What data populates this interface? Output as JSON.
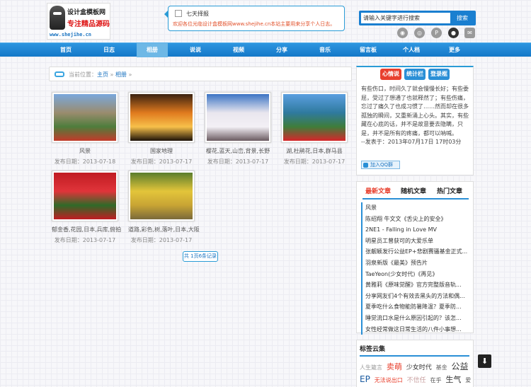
{
  "logo": {
    "title": "设计盒模板网",
    "slogan": "专注精品源码",
    "url": "www.shejihe.cn"
  },
  "notice": {
    "title": "七天择报",
    "text": "欢迎各位光临设计盒模板网www.shejihe.cn本站主要用来分享个人日志。"
  },
  "search": {
    "value": "请输入关键字进行搜索",
    "button": "搜索"
  },
  "social_icons": [
    "rss-icon",
    "weibo-icon",
    "qq-icon",
    "tencent-icon",
    "mail-icon"
  ],
  "nav": {
    "items": [
      "首页",
      "日志",
      "相册",
      "说说",
      "视频",
      "分享",
      "音乐",
      "留言板",
      "个人档",
      "更多"
    ],
    "active_index": 2
  },
  "breadcrumb": {
    "prefix": "当前位置：",
    "home": "主页",
    "sep": "»",
    "current": "相册",
    "end": "»"
  },
  "photos": [
    {
      "caption": "风景",
      "date": "发布日期：2013-07-18",
      "colors": [
        "#7aa8dc",
        "#9a8c6e",
        "#4e7d3c",
        "#c23a2a"
      ]
    },
    {
      "caption": "国家地理",
      "date": "发布日期：2013-07-17",
      "colors": [
        "#3a2210",
        "#e07a1e",
        "#f7c04a",
        "#1c1208"
      ]
    },
    {
      "caption": "樱花,蓝天,山峦,背景,长野",
      "date": "发布日期：2013-07-17",
      "colors": [
        "#3c74c4",
        "#e9e6ee",
        "#f3f0f5",
        "#6a5a60"
      ]
    },
    {
      "caption": "湖,杜鹃花,日本,群马县",
      "date": "发布日期：2013-07-17",
      "colors": [
        "#5b9fe0",
        "#2f7a9e",
        "#3f7d3a",
        "#d6262a"
      ]
    },
    {
      "caption": "郁金香,花园,日本,兵库,俯拍",
      "date": "发布日期：2013-07-17",
      "colors": [
        "#c01c22",
        "#e0343a",
        "#2f6a28",
        "#c01c22"
      ]
    },
    {
      "caption": "道路,彩色,树,落叶,日本,大阪",
      "date": "发布日期：2013-07-17",
      "colors": [
        "#5a7d2c",
        "#e3c53a",
        "#c8a434",
        "#7a6a3a"
      ]
    }
  ],
  "pager": "共 1页6条记录",
  "about": {
    "tabs": [
      "心情说",
      "统计栏",
      "登录框"
    ],
    "text": "有些伤口，时间久了就会慢慢长好；有些委屈，受过了想通了也就释然了；有些伤痛，忘过了痛久了也成习惯了……然而却在很多孤独的瞬间，又重新涌上心头。其实，有些藏在心底的话，并不是故意要去隐瞒，只是，并不是所有的疼痛，都可以呐喊。",
    "date": "--发表于：2013年07月17日 17时03分",
    "qq": "加入QQ群"
  },
  "articles": {
    "tabs": [
      "最新文章",
      "随机文章",
      "热门文章"
    ],
    "items": [
      "风景",
      "陈绍翔 牛文文《舌尖上的安全》",
      "2NE1 - Falling in Love MV",
      "明星员工曾获可的大爱乐单",
      "张靓颖发行公益EP+悲剧赛骚基金正式...",
      "羽泉新版《最美》预告片",
      "TaeYeon(少女时代)《再见》",
      "黄雅莉《原味觉醒》官方完整版音轨...",
      "分享网友们4个有效去黑头的方法和偶...",
      "夏季吃什么食物能防暑降温？夏季防...",
      "睡觉流口水是什么原因引起的？该怎...",
      "女性经常做这日常生活的八件小事想..."
    ]
  },
  "tags": {
    "title": "标签云集",
    "items": [
      {
        "text": "人生箴言",
        "size": 8,
        "color": "#9a9a9a"
      },
      {
        "text": "卖萌",
        "size": 11,
        "color": "#e8402e"
      },
      {
        "text": "少女时代",
        "size": 9,
        "color": "#333333"
      },
      {
        "text": "基金",
        "size": 8,
        "color": "#666666"
      },
      {
        "text": "公益",
        "size": 12,
        "color": "#333333"
      },
      {
        "text": "EP",
        "size": 12,
        "color": "#1a5aa0"
      },
      {
        "text": "无法说出口",
        "size": 8,
        "color": "#e8402e"
      },
      {
        "text": "不信任",
        "size": 9,
        "color": "#c8a0a0"
      },
      {
        "text": "在乎",
        "size": 8,
        "color": "#555555"
      },
      {
        "text": "生气",
        "size": 11,
        "color": "#333333"
      },
      {
        "text": "爱的",
        "size": 8,
        "color": "#555555"
      }
    ]
  },
  "backtop": "⬇"
}
